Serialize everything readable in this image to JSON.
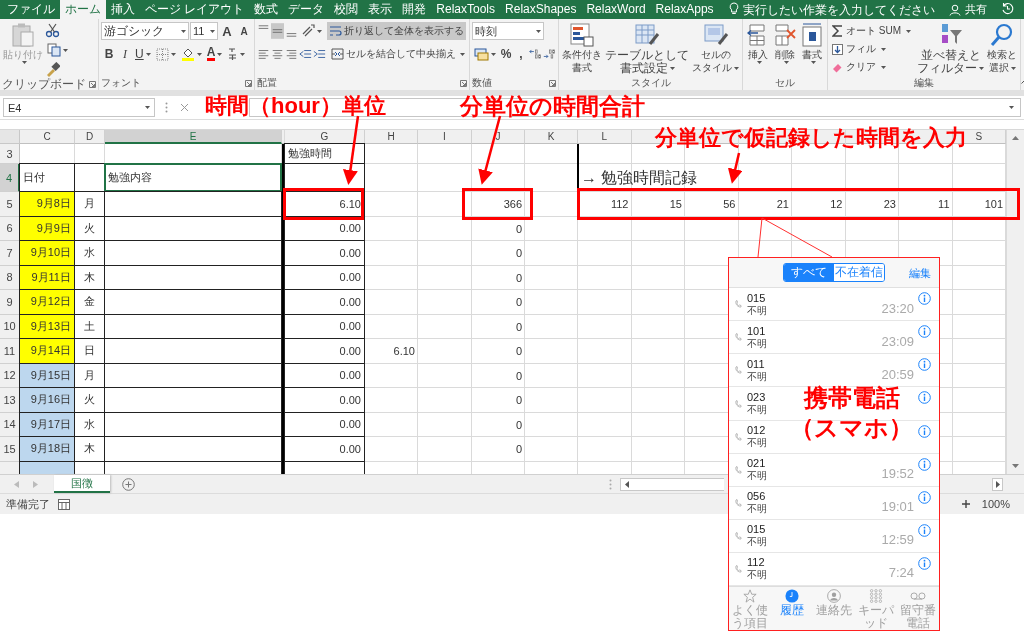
{
  "ribbon_tabs": [
    {
      "label": "ファイル",
      "selected": false
    },
    {
      "label": "ホーム",
      "selected": true
    },
    {
      "label": "挿入",
      "selected": false
    },
    {
      "label": "ページ レイアウト",
      "selected": false
    },
    {
      "label": "数式",
      "selected": false
    },
    {
      "label": "データ",
      "selected": false
    },
    {
      "label": "校閲",
      "selected": false
    },
    {
      "label": "表示",
      "selected": false
    },
    {
      "label": "開発",
      "selected": false
    },
    {
      "label": "RelaxTools",
      "selected": false
    },
    {
      "label": "RelaxShapes",
      "selected": false
    },
    {
      "label": "RelaxWord",
      "selected": false
    },
    {
      "label": "RelaxApps",
      "selected": false
    }
  ],
  "tell_me": {
    "placeholder": "実行したい作業を入力してください"
  },
  "share": "共有",
  "clipboard": {
    "label": "クリップボード",
    "paste": "貼り付け",
    "paste_disabled": true
  },
  "font": {
    "label": "フォント",
    "name": "游ゴシック",
    "size": "11",
    "grow": "A",
    "shrink": "A",
    "bold": "B",
    "italic": "I",
    "underline": "U",
    "color_letter": "A"
  },
  "alignment": {
    "label": "配置",
    "middle_on": true,
    "wrap": "折り返して全体を表示する",
    "wrap_on": true,
    "merge": "セルを結合して中央揃え"
  },
  "number": {
    "label": "数値",
    "format": "時刻",
    "percent": "%",
    "comma": ","
  },
  "styles": {
    "label": "スタイル",
    "buttons": [
      "条件付き書式",
      "テーブルとして書式設定",
      "セルのスタイル"
    ]
  },
  "cells": {
    "label": "セル",
    "buttons": [
      "挿入",
      "削除",
      "書式"
    ]
  },
  "editing": {
    "label": "編集",
    "autosum": "オート SUM",
    "fill": "フィル",
    "clear": "クリア",
    "buttons": [
      "並べ替えとフィルター",
      "検索と選択"
    ]
  },
  "name_box": "E4",
  "columns": [
    {
      "label": "C",
      "kind": "date",
      "selected": false
    },
    {
      "label": "D",
      "kind": "day",
      "selected": false
    },
    {
      "label": "E",
      "kind": "content",
      "selected": true
    },
    {
      "kind": "divider"
    },
    {
      "label": "G",
      "kind": "hours",
      "selected": false
    },
    {
      "label": "H",
      "kind": "col_h",
      "selected": false
    },
    {
      "label": "I",
      "kind": "blank",
      "selected": false
    },
    {
      "label": "J",
      "kind": "minutes",
      "selected": false
    },
    {
      "label": "K",
      "kind": "blank",
      "selected": false
    },
    {
      "label": "L",
      "kind": "log",
      "selected": false
    },
    {
      "kind": "log"
    },
    {
      "kind": "log"
    },
    {
      "kind": "log"
    },
    {
      "kind": "log"
    },
    {
      "kind": "log"
    },
    {
      "kind": "log"
    },
    {
      "label": "S",
      "kind": "log",
      "selected": false
    }
  ],
  "rows": [
    {
      "num": "3",
      "kind": "caption",
      "selected": false,
      "hours": "勉強時間"
    },
    {
      "num": "4",
      "kind": "header",
      "selected": true,
      "date": "日付",
      "content": "勉強内容",
      "log": [
        "→ 勉強時間記録"
      ]
    },
    {
      "num": "5",
      "kind": "day",
      "selected": false,
      "color": "#ffff00",
      "date": "9月8日",
      "day": "月",
      "hours": "6.10",
      "minutes": "366",
      "log": [
        "112",
        "15",
        "56",
        "21",
        "12",
        "23",
        "11",
        "101"
      ]
    },
    {
      "num": "6",
      "kind": "day",
      "selected": false,
      "color": "#ffff00",
      "date": "9月9日",
      "day": "火",
      "hours": "0.00",
      "minutes": "0"
    },
    {
      "num": "7",
      "kind": "day",
      "selected": false,
      "color": "#ffff00",
      "date": "9月10日",
      "day": "水",
      "hours": "0.00",
      "minutes": "0"
    },
    {
      "num": "8",
      "kind": "day",
      "selected": false,
      "color": "#ffff00",
      "date": "9月11日",
      "day": "木",
      "hours": "0.00",
      "minutes": "0"
    },
    {
      "num": "9",
      "kind": "day",
      "selected": false,
      "color": "#ffff00",
      "date": "9月12日",
      "day": "金",
      "hours": "0.00",
      "minutes": "0"
    },
    {
      "num": "10",
      "kind": "day",
      "selected": false,
      "color": "#ffff00",
      "date": "9月13日",
      "day": "土",
      "hours": "0.00",
      "minutes": "0"
    },
    {
      "num": "11",
      "kind": "day",
      "selected": false,
      "color": "#ffff00",
      "date": "9月14日",
      "day": "日",
      "hours": "0.00",
      "col_h": "6.10",
      "minutes": "0"
    },
    {
      "num": "12",
      "kind": "day",
      "selected": false,
      "color": "#bdd7ee",
      "date": "9月15日",
      "day": "月",
      "hours": "0.00",
      "minutes": "0"
    },
    {
      "num": "13",
      "kind": "day",
      "selected": false,
      "color": "#bdd7ee",
      "date": "9月16日",
      "day": "火",
      "hours": "0.00",
      "minutes": "0"
    },
    {
      "num": "14",
      "kind": "day",
      "selected": false,
      "color": "#bdd7ee",
      "date": "9月17日",
      "day": "水",
      "hours": "0.00",
      "minutes": "0"
    },
    {
      "num": "15",
      "kind": "day",
      "selected": false,
      "color": "#bdd7ee",
      "date": "9月18日",
      "day": "木",
      "hours": "0.00",
      "minutes": "0"
    },
    {
      "kind": "day",
      "selected": false,
      "color": "#bdd7ee"
    }
  ],
  "sheet_tabs": [
    {
      "label": "国徴",
      "selected": true
    }
  ],
  "status": "準備完了",
  "zoom": "100%",
  "phone": {
    "segments": [
      {
        "label": "すべて",
        "selected": true
      },
      {
        "label": "不在着信",
        "selected": false
      }
    ],
    "edit": "編集",
    "calls": [
      {
        "number": "015",
        "label": "不明",
        "time": "23:20"
      },
      {
        "number": "101",
        "label": "不明",
        "time": "23:09"
      },
      {
        "number": "011",
        "label": "不明",
        "time": "20:59"
      },
      {
        "number": "023",
        "label": "不明"
      },
      {
        "number": "012",
        "label": "不明"
      },
      {
        "number": "021",
        "label": "不明",
        "time": "19:52"
      },
      {
        "number": "056",
        "label": "不明",
        "time": "19:01"
      },
      {
        "number": "015",
        "label": "不明",
        "time": "12:59"
      },
      {
        "number": "112",
        "label": "不明",
        "time": "7:24"
      }
    ],
    "tabs": [
      {
        "label": "よく使う項目",
        "selected": false
      },
      {
        "label": "履歴",
        "selected": true
      },
      {
        "label": "連絡先",
        "selected": false
      },
      {
        "label": "キーパッド",
        "selected": false
      },
      {
        "label": "留守番電話",
        "selected": false
      }
    ]
  },
  "annotations": [
    "時間（hour）単位",
    "分単位の時間合計",
    "分単位で仮記録した時間を入力",
    "携帯電話（スマホ）"
  ]
}
